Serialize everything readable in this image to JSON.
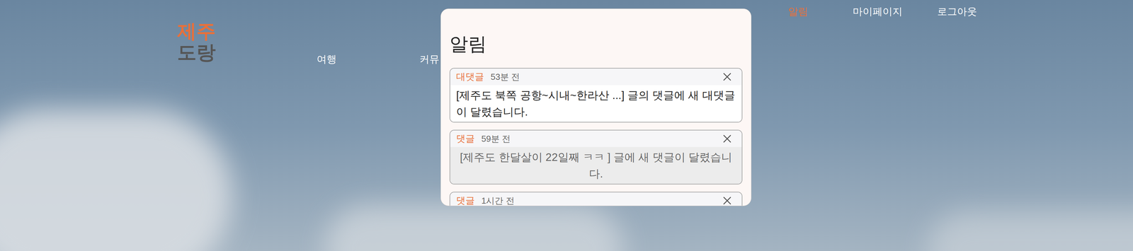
{
  "logo": {
    "lines": [
      "제주",
      "도랑"
    ]
  },
  "nav": [
    {
      "label": "여행"
    },
    {
      "label": "커뮤"
    }
  ],
  "top_links": [
    {
      "label": "알림",
      "selected": true
    },
    {
      "label": "마이페이지",
      "selected": false
    },
    {
      "label": "로그아웃",
      "selected": false
    }
  ],
  "popup": {
    "title": "알림",
    "notifications": [
      {
        "type": "대댓글",
        "time": "53분 전",
        "message": "[제주도 북쪽 공항~시내~한라산 ...] 글의 댓글에 새 대댓글이 달렸습니다.",
        "read": false
      },
      {
        "type": "댓글",
        "time": "59분 전",
        "message": "[제주도 한달살이 22일째 ㅋㅋ ] 글에 새 댓글이 달렸습니다.",
        "read": true
      },
      {
        "type": "댓글",
        "time": "1시간 전",
        "message": "",
        "read": true
      }
    ]
  }
}
